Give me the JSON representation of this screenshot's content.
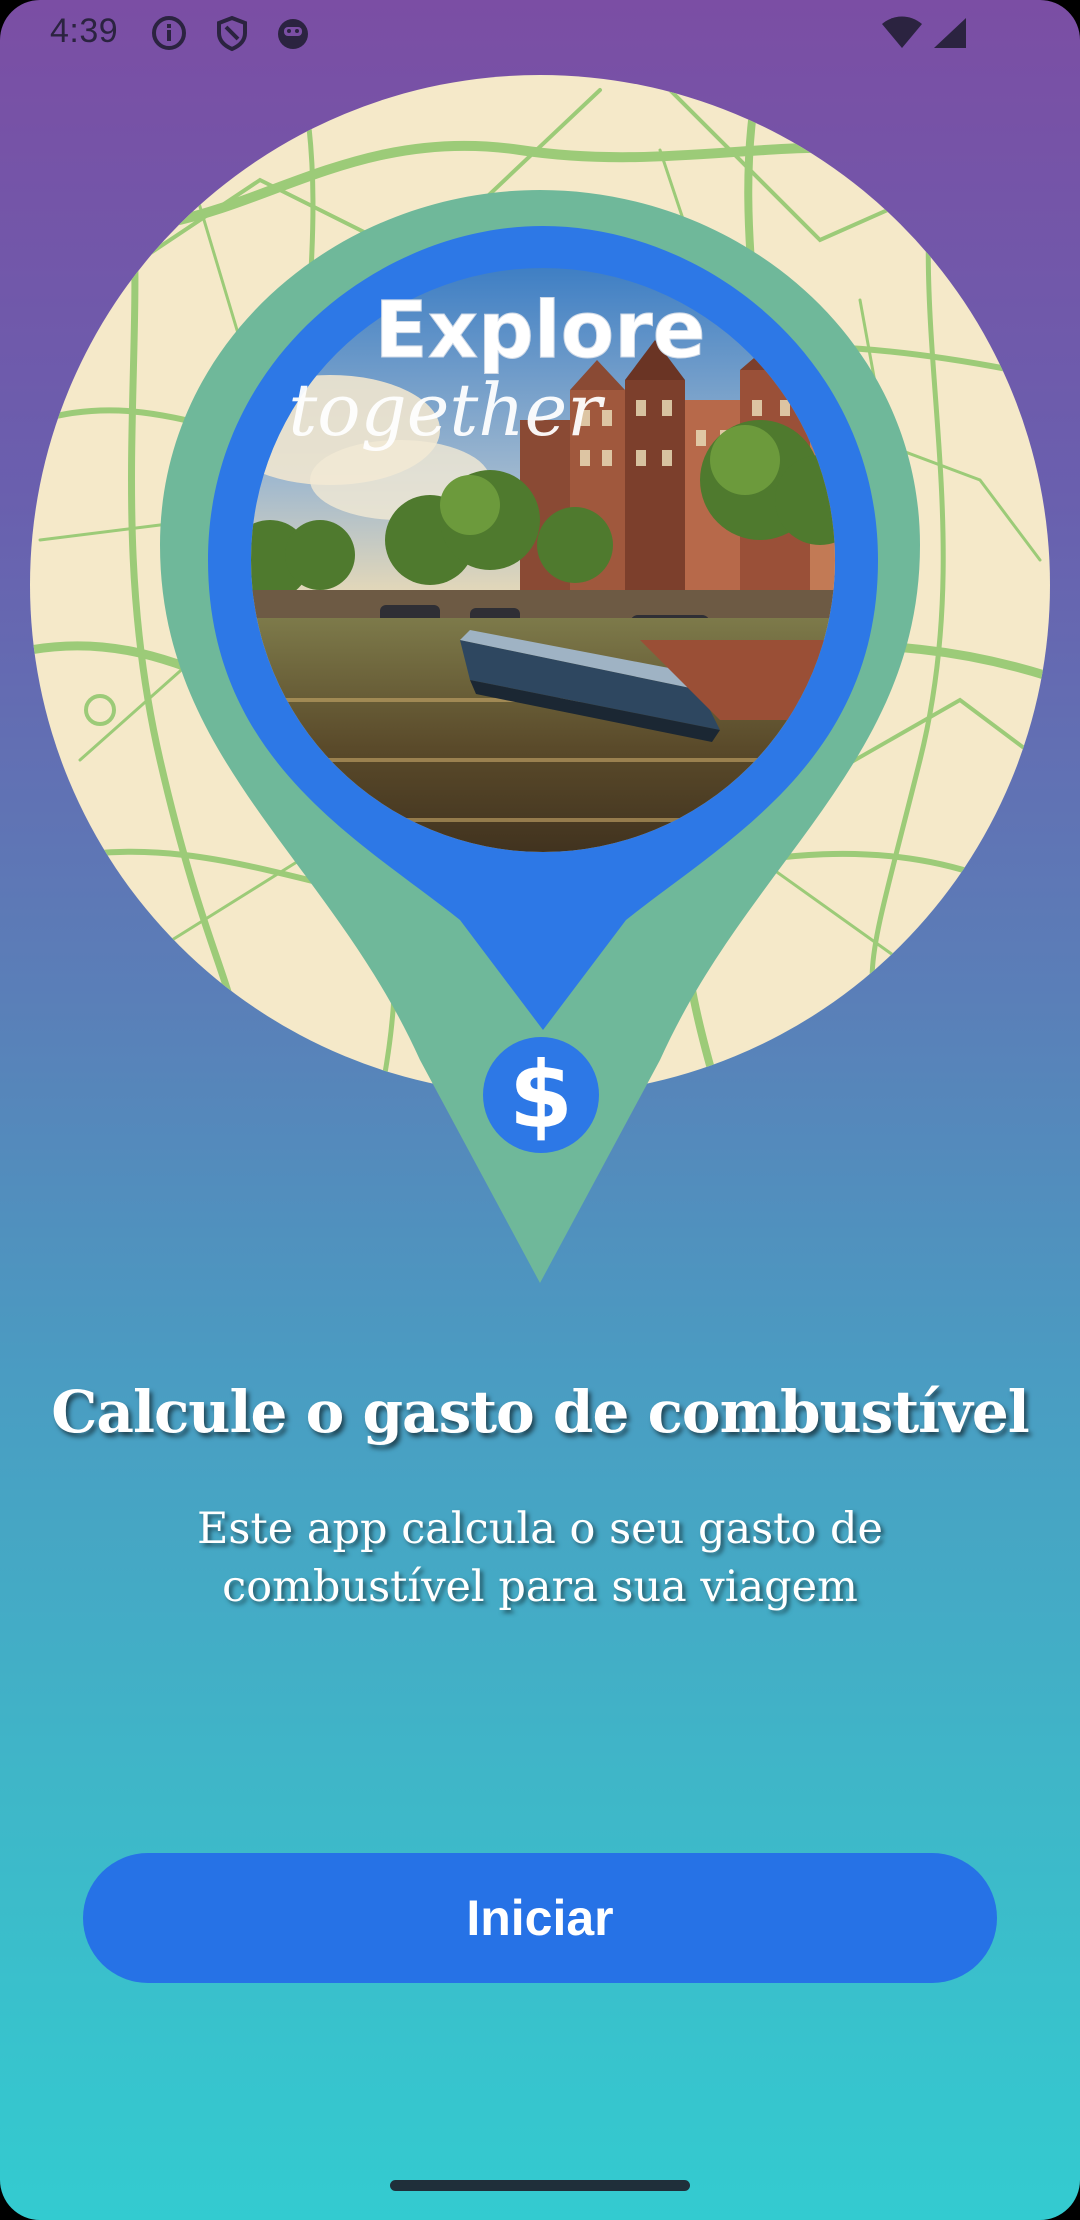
{
  "status_bar": {
    "time": "4:39",
    "icons_left": [
      "info-icon",
      "shield-icon",
      "face-icon"
    ],
    "icons_right": [
      "wifi-icon",
      "signal-icon"
    ]
  },
  "hero": {
    "badge_title": "Explore",
    "badge_script": "together",
    "currency_symbol": "$",
    "colors": {
      "map_background": "#f5e9c9",
      "map_roads": "#9ccb78",
      "pin_outer": "#6fb89a",
      "pin_inner": "#2d78e6",
      "currency_badge": "#2d78e6"
    }
  },
  "content": {
    "title": "Calcule o gasto de combustível",
    "subtitle": "Este app calcula o seu gasto de combustível para sua viagem"
  },
  "actions": {
    "start_label": "Iniciar"
  },
  "theme": {
    "gradient_top": "#7b4ea4",
    "gradient_bottom": "#33cbd0",
    "button_color": "#2672e6"
  }
}
